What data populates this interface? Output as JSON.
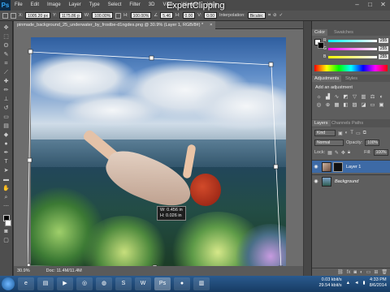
{
  "app": {
    "logo": "Ps"
  },
  "watermark": "ExpertClipping",
  "menu": [
    "File",
    "Edit",
    "Image",
    "Layer",
    "Type",
    "Select",
    "Filter",
    "3D",
    "View",
    "Window",
    "Help"
  ],
  "options": {
    "x_label": "X:",
    "x_value": "1005.20 px",
    "y_label": "Y:",
    "y_value": "1175.86 p",
    "w_label": "W:",
    "w_value": "100.00%",
    "h_label": "H:",
    "h_value": "100.00%",
    "angle_value": "5.46",
    "h2_label": "H:",
    "h2_value": "0.00",
    "v_label": "V:",
    "v_value": "0.00",
    "interp_label": "Interpolation:",
    "interp_value": "Bicubic"
  },
  "document": {
    "tab_title": "pinmade_background_25_underwater_by_frostbe-d1ngdes.png @ 30.9% (Layer 1, RGB/8#) *"
  },
  "readout": {
    "w": "W: 0.456 in",
    "h": "H: 0.026 in"
  },
  "status": {
    "zoom": "30.9%",
    "doc": "Doc: 11.4M/11.4M"
  },
  "color_panel": {
    "tabs": [
      "Color",
      "Swatches"
    ],
    "sliders": [
      {
        "label": "R",
        "value": "255"
      },
      {
        "label": "G",
        "value": "255"
      },
      {
        "label": "B",
        "value": "255"
      }
    ]
  },
  "adjustments": {
    "tabs": [
      "Adjustments",
      "Styles"
    ],
    "title": "Add an adjustment"
  },
  "layers_panel": {
    "tabs": [
      "Layers",
      "Channels",
      "Paths"
    ],
    "kind_label": "Kind",
    "blend_mode": "Normal",
    "opacity_label": "Opacity:",
    "opacity_value": "100%",
    "lock_label": "Lock:",
    "fill_label": "Fill:",
    "fill_value": "100%",
    "layers": [
      {
        "name": "Layer 1",
        "selected": true
      },
      {
        "name": "Background",
        "selected": false
      }
    ]
  },
  "taskbar": {
    "net_up": "0.03 kbit/s",
    "net_down": "29.54 kbit/s",
    "time": "4:33 PM",
    "date": "8/6/2014"
  }
}
